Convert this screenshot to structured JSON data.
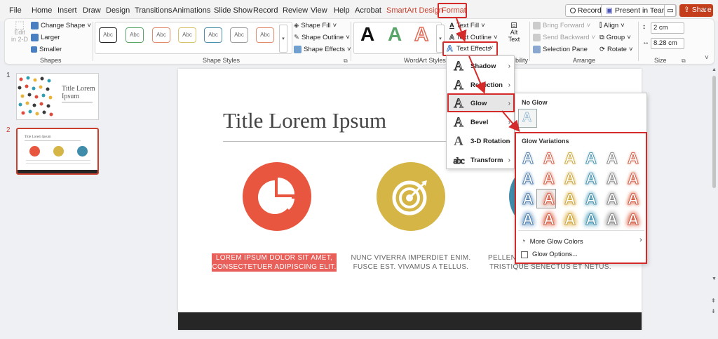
{
  "menubar": {
    "tabs": [
      "File",
      "Home",
      "Insert",
      "Draw",
      "Design",
      "Transitions",
      "Animations",
      "Slide Show",
      "Record",
      "Review",
      "View",
      "Help",
      "Acrobat",
      "SmartArt Design",
      "Format"
    ],
    "record": "Record",
    "present": "Present in Teams",
    "share": "Share"
  },
  "ribbon": {
    "edit2d_1": "Edit",
    "edit2d_2": "in 2-D",
    "change_shape": "Change Shape",
    "larger": "Larger",
    "smaller": "Smaller",
    "shapes_label": "Shapes",
    "abc": "Abc",
    "shape_fill": "Shape Fill",
    "shape_outline": "Shape Outline",
    "shape_effects": "Shape Effects",
    "shape_styles_label": "Shape Styles",
    "wordart_letter": "A",
    "text_fill": "Text Fill",
    "text_outline": "Text Outline",
    "text_effects": "Text Effects",
    "wordart_label": "WordArt Styles",
    "alt_text_1": "Alt",
    "alt_text_2": "Text",
    "accessibility_label": "bility",
    "bring_forward": "Bring Forward",
    "send_backward": "Send Backward",
    "selection_pane": "Selection Pane",
    "align": "Align",
    "group": "Group",
    "rotate": "Rotate",
    "arrange_label": "Arrange",
    "height": "2 cm",
    "width": "8.28 cm",
    "size_label": "Size"
  },
  "thumbs": {
    "n1": "1",
    "n2": "2",
    "t1_title": "Title Lorem Ipsum",
    "t2_title": "Title Lorem Ipsum"
  },
  "slide": {
    "title": "Title Lorem Ipsum",
    "cap1_l1": "LOREM IPSUM DOLOR SIT AMET,",
    "cap1_l2": "CONSECTETUER ADIPISCING ELIT.",
    "cap2_l1": "NUNC VIVERRA IMPERDIET ENIM.",
    "cap2_l2": "FUSCE EST. VIVAMUS A TELLUS.",
    "cap3_l1": "PELLENT",
    "cap3_l2": "TRISTIQUE SENECTUS ET NETUS."
  },
  "text_effects_menu": {
    "items": [
      "Shadow",
      "Reflection",
      "Glow",
      "Bevel",
      "3-D Rotation",
      "Transform"
    ]
  },
  "glow_panel": {
    "no_glow": "No Glow",
    "variations": "Glow Variations",
    "more_colors": "More Glow Colors",
    "options": "Glow Options..."
  },
  "colors": {
    "accent": "#c9402e",
    "callout": "#d42a2a",
    "circle1": "#e8563f",
    "circle2": "#d4b545",
    "circle3": "#3f8dab"
  }
}
